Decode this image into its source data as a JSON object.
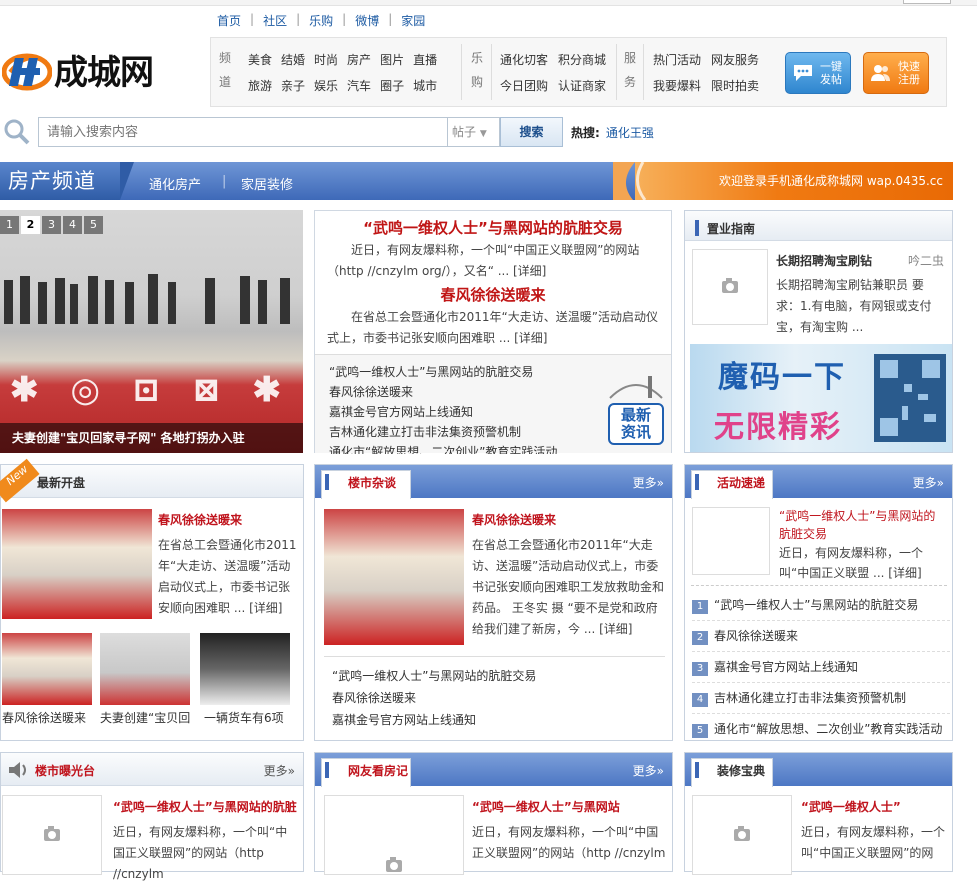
{
  "top_nav": [
    "首页",
    "社区",
    "乐购",
    "微博",
    "家园"
  ],
  "logo": {
    "text": "成城网"
  },
  "channels": {
    "label_pindao": "频道",
    "pindao_row1": [
      "美食",
      "结婚",
      "时尚",
      "房产",
      "图片",
      "直播"
    ],
    "pindao_row2": [
      "旅游",
      "亲子",
      "娱乐",
      "汽车",
      "圈子",
      "城市"
    ],
    "label_legou": "乐购",
    "legou_row1": [
      "通化切客",
      "积分商城"
    ],
    "legou_row2": [
      "今日团购",
      "认证商家"
    ],
    "label_fuwu": "服务",
    "fuwu_row1": [
      "热门活动",
      "网友服务"
    ],
    "fuwu_row2": [
      "我要爆料",
      "限时拍卖"
    ]
  },
  "buttons": {
    "post_l1": "一键",
    "post_l2": "发帖",
    "reg_l1": "快速",
    "reg_l2": "注册"
  },
  "search": {
    "placeholder": "请输入搜索内容",
    "type": "帖子",
    "button": "搜索",
    "hot_label": "热搜:",
    "hot_keyword": "通化王强"
  },
  "banner": {
    "title": "房产频道",
    "link1": "通化房产",
    "link2": "家居装修",
    "welcome": "欢迎登录手机通化成称城网 wap.0435.cc"
  },
  "slider": {
    "pages": [
      "1",
      "2",
      "3",
      "4",
      "5"
    ],
    "active": "2",
    "caption": "夫妻创建\"宝贝回家寻子网\" 各地打拐办入驻"
  },
  "headline": {
    "title1": "“武鸣一维权人士”与黑网站的肮脏交易",
    "text1": "近日，有网友爆料称，一个叫“中国正义联盟网”的网站（http //cnzylm org/），又名“ ... [详细]",
    "title2": "春风徐徐送暖来",
    "text2": "在省总工会暨通化市2011年“大走访、送温暖”活动启动仪式上，市委书记张安顺向困难职 ... [详细]",
    "list": [
      "“武鸣一维权人士”与黑网站的肮脏交易",
      "春风徐徐送暖来",
      "嘉祺金号官方网站上线通知",
      "吉林通化建立打击非法集资预警机制",
      "通化市“解放思想、二次创业”教育实践活动"
    ],
    "badge_l1": "最新",
    "badge_l2": "资讯"
  },
  "guide": {
    "title": "置业指南",
    "item_title": "长期招聘淘宝刷钻",
    "item_author": "吟二虫",
    "item_text": "长期招聘淘宝刷钻兼职员 要求：1.有电脑，有网银或支付宝，有淘宝购 ...",
    "ad_l1": "魔码一下",
    "ad_l2": "无限精彩"
  },
  "latest": {
    "title": "最新开盘",
    "ribbon": "New",
    "item_title": "春风徐徐送暖来",
    "item_text": "在省总工会暨通化市2011年“大走访、送温暖”活动启动仪式上，市委书记张安顺向困难职 ... [详细]",
    "thumbs": [
      "春风徐徐送暖来",
      "夫妻创建“宝贝回",
      "一辆货车有6项"
    ]
  },
  "market": {
    "title": "楼市杂谈",
    "more": "更多»",
    "item_title": "春风徐徐送暖来",
    "item_text": "在省总工会暨通化市2011年“大走访、送温暖”活动启动仪式上，市委书记张安顺向困难职工发放救助金和药品。 王冬实 摄 “要不是党和政府给我们建了新房，今 ... [详细]",
    "list": [
      "“武鸣一维权人士”与黑网站的肮脏交易",
      "春风徐徐送暖来",
      "嘉祺金号官方网站上线通知"
    ]
  },
  "activity": {
    "title": "活动速递",
    "more": "更多»",
    "item_title": "“武鸣一维权人士”与黑网站的肮脏交易",
    "item_text": "近日，有网友爆料称，一个叫“中国正义联盟 ... [详细]",
    "list": [
      "“武鸣一维权人士”与黑网站的肮脏交易",
      "春风徐徐送暖来",
      "嘉祺金号官方网站上线通知",
      "吉林通化建立打击非法集资预警机制",
      "通化市“解放思想、二次创业”教育实践活动"
    ]
  },
  "exposure": {
    "title": "楼市曝光台",
    "more": "更多»",
    "item_title": "“武鸣一维权人士”与黑网站的肮脏",
    "item_text": "近日，有网友爆料称，一个叫“中国正义联盟网”的网站（http //cnzylm"
  },
  "netizen": {
    "title": "网友看房记",
    "more": "更多»",
    "item_title": "“武鸣一维权人士”与黑网站",
    "item_text": "近日，有网友爆料称，一个叫“中国正义联盟网”的网站（http //cnzylm"
  },
  "decor": {
    "title": "装修宝典",
    "item_title": "“武鸣一维权人士”",
    "item_text": "近日，有网友爆料称，一个叫“中国正义联盟网”的网"
  },
  "colors": {
    "blue": "#3b66b5",
    "red": "#c0141d",
    "orange": "#f07a12"
  }
}
